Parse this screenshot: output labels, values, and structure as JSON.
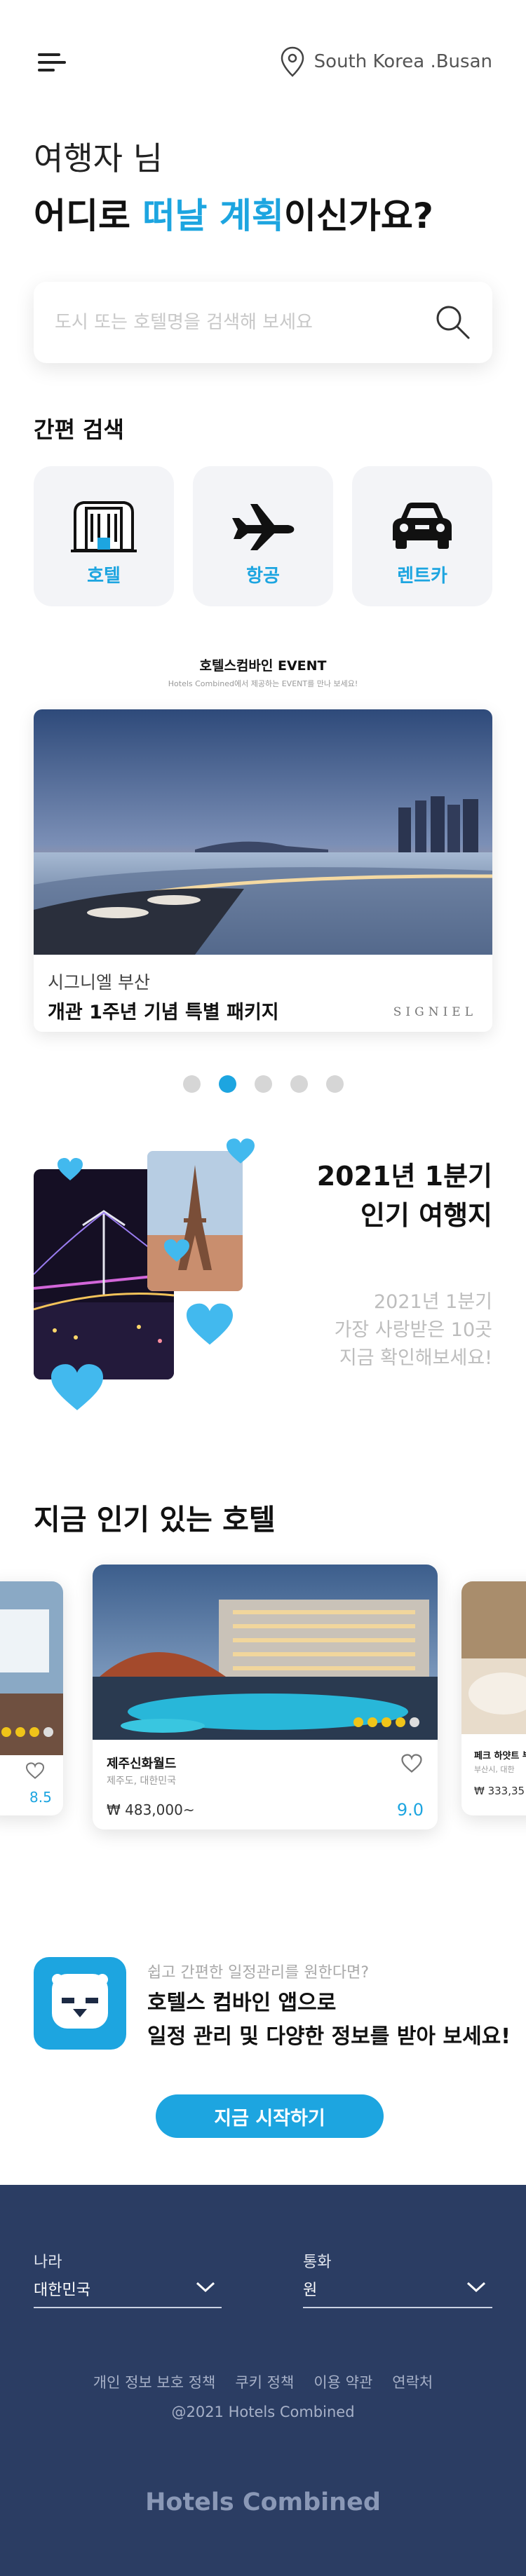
{
  "header": {
    "location": "South Korea .Busan",
    "menu_icon": "hamburger-icon",
    "location_icon": "map-pin-icon"
  },
  "greeting": {
    "line1": "여행자 님",
    "line2_prefix": "어디로 ",
    "line2_highlight": "떠날 계획",
    "line2_suffix": "이신가요?"
  },
  "search": {
    "placeholder": "도시 또는 호텔명을 검색해 보세요",
    "icon": "search-icon"
  },
  "quick_search": {
    "title": "간편 검색",
    "items": [
      {
        "label": "호텔",
        "icon": "hotel-building-icon"
      },
      {
        "label": "항공",
        "icon": "airplane-icon"
      },
      {
        "label": "렌트카",
        "icon": "car-icon"
      }
    ]
  },
  "event": {
    "title": "호텔스컴바인 EVENT",
    "subtitle": "Hotels Combined에서 제공하는 EVENT를 만나 보세요!",
    "card": {
      "hotel": "시그니엘 부산",
      "headline": "개관 1주년 기념 특별 패키지",
      "brand": "SIGNIEL"
    },
    "pagination": {
      "count": 5,
      "active": 2
    }
  },
  "popular": {
    "title_line1": "2021년 1분기",
    "title_line2": "인기 여행지",
    "desc_line1": "2021년 1분기",
    "desc_line2": "가장 사랑받은 10곳",
    "desc_line3": "지금 확인해보세요!"
  },
  "hotels": {
    "title": "지금 인기 있는 호텔",
    "left_peek": {
      "score": "8.5"
    },
    "main": {
      "name": "제주신화월드",
      "location": "제주도, 대한민국",
      "price": "₩ 483,000~",
      "score": "9.0",
      "rating": 4
    },
    "right_peek": {
      "name": "페크 하얏트 부",
      "location": "부산시, 대한",
      "price": "₩ 333,35"
    }
  },
  "app_promo": {
    "question": "쉽고 간편한 일정관리를 원한다면?",
    "line1": "호텔스 컴바인 앱으로",
    "line2": "일정 관리 및 다양한 정보를 받아 보세요!",
    "cta": "지금 시작하기"
  },
  "footer": {
    "country_label": "나라",
    "country_value": "대한민국",
    "currency_label": "통화",
    "currency_value": "원",
    "links": [
      "개인 정보 보호 정책",
      "쿠키 정책",
      "이용 약관",
      "연락처"
    ],
    "copyright": "@2021 Hotels Combined",
    "brand": "Hotels Combined"
  },
  "colors": {
    "accent": "#1da5e0",
    "footer_bg": "#2b3d63",
    "card_bg": "#f3f4f7"
  }
}
